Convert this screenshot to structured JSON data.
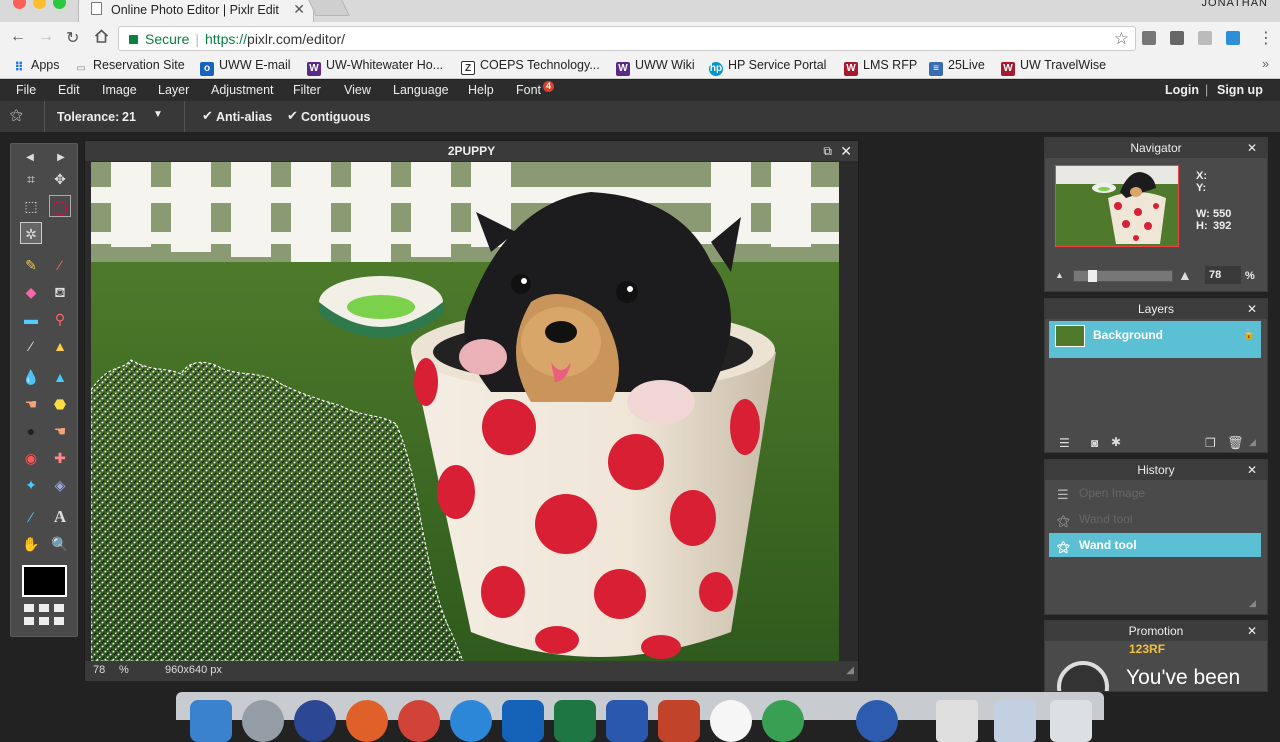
{
  "browser": {
    "tab_title": "Online Photo Editor | Pixlr Edit",
    "user": "JONATHAN",
    "secure_label": "Secure",
    "url_scheme": "https://",
    "url_rest": "pixlr.com/editor/",
    "bookmarks": [
      {
        "label": "Apps",
        "icon": "apps-grid-icon"
      },
      {
        "label": "Reservation Site",
        "icon": "reservation-site-icon"
      },
      {
        "label": "UWW E-mail",
        "icon": "outlook-icon"
      },
      {
        "label": "UW-Whitewater Ho...",
        "icon": "uww-icon"
      },
      {
        "label": "COEPS Technology...",
        "icon": "zendesk-icon"
      },
      {
        "label": "UWW Wiki",
        "icon": "uww-icon"
      },
      {
        "label": "HP Service Portal",
        "icon": "hp-icon"
      },
      {
        "label": "LMS RFP",
        "icon": "uw-icon"
      },
      {
        "label": "25Live",
        "icon": "25live-icon"
      },
      {
        "label": "UW TravelWise",
        "icon": "uw-icon"
      }
    ]
  },
  "editor": {
    "menu": [
      "File",
      "Edit",
      "Image",
      "Layer",
      "Adjustment",
      "Filter",
      "View",
      "Language",
      "Help",
      "Font"
    ],
    "font_badge": "4",
    "login": "Login",
    "signup": "Sign up",
    "tolerance_label": "Tolerance:",
    "tolerance_value": "21",
    "anti_alias_label": "Anti-alias",
    "contiguous_label": "Contiguous",
    "document_title": "2PUPPY",
    "zoom": "78",
    "zoom_unit": "%",
    "image_size": "960x640 px"
  },
  "navigator": {
    "title": "Navigator",
    "x_label": "X:",
    "y_label": "Y:",
    "w_label": "W:",
    "w_value": "550",
    "h_label": "H:",
    "h_value": "392",
    "zoom": "78",
    "zoom_unit": "%"
  },
  "layers": {
    "title": "Layers",
    "items": [
      {
        "name": "Background"
      }
    ]
  },
  "history": {
    "title": "History",
    "items": [
      {
        "label": "Open Image",
        "state": "dimmed"
      },
      {
        "label": "Wand tool",
        "state": "dimmed"
      },
      {
        "label": "Wand tool",
        "state": "active"
      }
    ]
  },
  "promotion": {
    "title": "Promotion",
    "brand": "123RF",
    "text": "You've been"
  },
  "colors": {
    "accent": "#5bc0d3",
    "panel": "#4a4a4a",
    "menu": "#2c2c2c",
    "secure_green": "#0b8043",
    "cup_red": "#d91f34"
  }
}
